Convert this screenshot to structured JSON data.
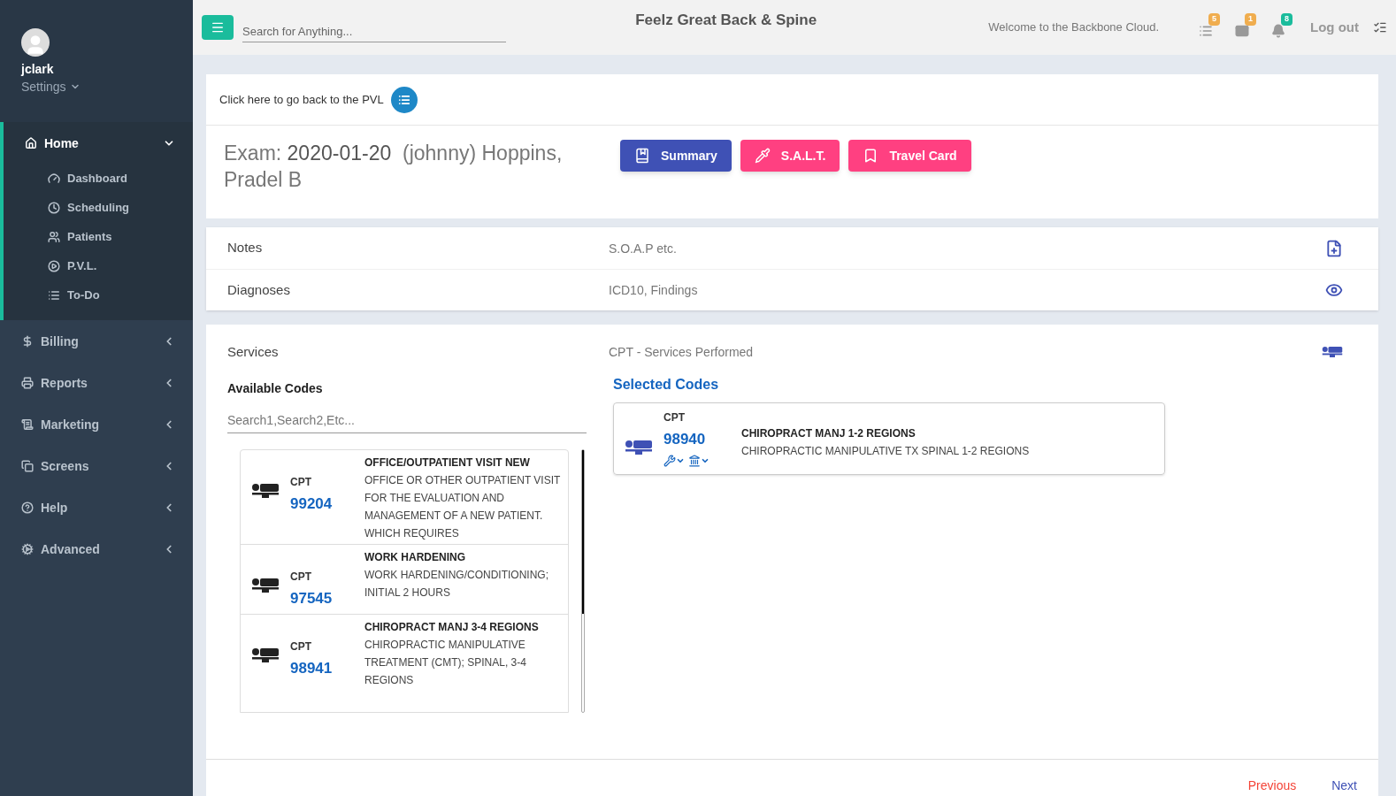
{
  "sidebar": {
    "user": "jclark",
    "settings": "Settings",
    "items": [
      {
        "label": "Home",
        "expanded": true,
        "children": [
          {
            "label": "Dashboard"
          },
          {
            "label": "Scheduling"
          },
          {
            "label": "Patients"
          },
          {
            "label": "P.V.L."
          },
          {
            "label": "To-Do"
          }
        ]
      },
      {
        "label": "Billing",
        "expanded": false
      },
      {
        "label": "Reports",
        "expanded": false
      },
      {
        "label": "Marketing",
        "expanded": false
      },
      {
        "label": "Screens",
        "expanded": false
      },
      {
        "label": "Help",
        "expanded": false
      },
      {
        "label": "Advanced",
        "expanded": false
      }
    ]
  },
  "topbar": {
    "search_placeholder": "Search for Anything...",
    "title": "Feelz Great Back & Spine",
    "welcome": "Welcome to the Backbone Cloud.",
    "badges": [
      {
        "count": "5",
        "color": "#f0ad4e"
      },
      {
        "count": "1",
        "color": "#f0ad4e"
      },
      {
        "count": "8",
        "color": "#1abc9c"
      }
    ],
    "logout": "Log out"
  },
  "back_link": "Click here to go back to the PVL",
  "exam": {
    "label": "Exam:",
    "date": "2020-01-20",
    "patient": "(johnny) Hoppins, Pradel B"
  },
  "actions": [
    {
      "label": "Summary",
      "color": "#3f51b5"
    },
    {
      "label": "S.A.L.T.",
      "color": "#ff4081"
    },
    {
      "label": "Travel Card",
      "color": "#ff4081"
    }
  ],
  "rows": [
    {
      "label": "Notes",
      "description": "S.O.A.P etc."
    },
    {
      "label": "Diagnoses",
      "description": "ICD10, Findings"
    }
  ],
  "services": {
    "label": "Services",
    "description": "CPT - Services Performed",
    "available_title": "Available Codes",
    "search_placeholder": "Search1,Search2,Etc...",
    "available": [
      {
        "type": "CPT",
        "code": "99204",
        "title": "OFFICE/OUTPATIENT VISIT NEW",
        "description": "OFFICE OR OTHER OUTPATIENT VISIT FOR THE EVALUATION AND MANAGEMENT OF A NEW PATIENT. WHICH REQUIRES"
      },
      {
        "type": "CPT",
        "code": "97545",
        "title": "WORK HARDENING",
        "description": "WORK HARDENING/CONDITIONING; INITIAL 2 HOURS"
      },
      {
        "type": "CPT",
        "code": "98941",
        "title": "CHIROPRACT MANJ 3-4 REGIONS",
        "description": "CHIROPRACTIC MANIPULATIVE TREATMENT (CMT); SPINAL, 3-4 REGIONS"
      }
    ],
    "selected_title": "Selected Codes",
    "selected": [
      {
        "type": "CPT",
        "code": "98940",
        "title": "CHIROPRACT MANJ 1-2 REGIONS",
        "description": "CHIROPRACTIC MANIPULATIVE TX SPINAL 1-2 REGIONS"
      }
    ]
  },
  "pager": {
    "previous": "Previous",
    "next": "Next"
  }
}
